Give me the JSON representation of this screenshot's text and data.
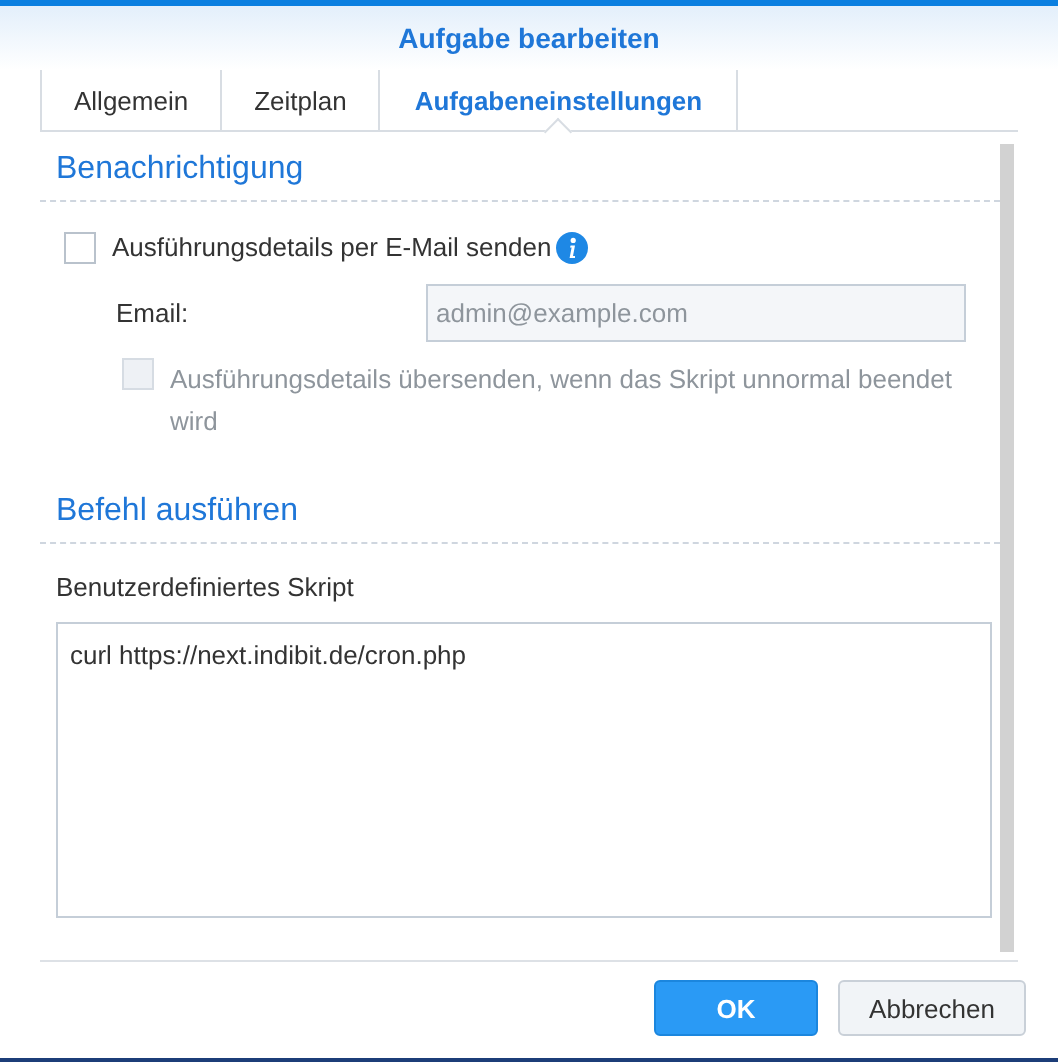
{
  "window": {
    "title": "Aufgabe bearbeiten"
  },
  "tabs": [
    {
      "label": "Allgemein",
      "selected": false
    },
    {
      "label": "Zeitplan",
      "selected": false
    },
    {
      "label": "Aufgabeneinstellungen",
      "selected": true
    }
  ],
  "sections": [
    {
      "title": "Benachrichtigung",
      "items": [
        {
          "kind": "checkbox",
          "label": "Ausführungsdetails per E-Mail senden",
          "checked": false,
          "disabled": false,
          "info": true
        },
        {
          "kind": "field",
          "label": "Email:",
          "value": "admin@example.com",
          "disabled": true
        },
        {
          "kind": "checkbox",
          "label": "Ausführungsdetails übersenden, wenn das Skript unnormal beendet wird",
          "checked": false,
          "disabled": true,
          "info": false
        }
      ]
    },
    {
      "title": "Befehl ausführen",
      "items": [
        {
          "kind": "textarea",
          "label": "Benutzerdefiniertes Skript",
          "value": "curl https://next.indibit.de/cron.php"
        }
      ]
    }
  ],
  "buttons": [
    {
      "label": "OK",
      "kind": "primary"
    },
    {
      "label": "Abbrechen",
      "kind": "secondary"
    }
  ]
}
